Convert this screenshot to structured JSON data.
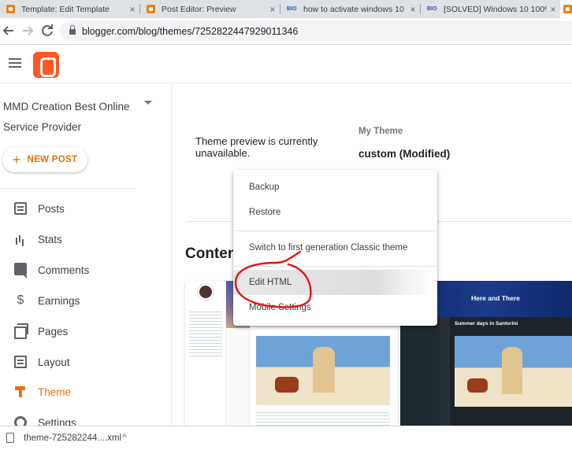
{
  "browser": {
    "tabs": [
      {
        "label": "Template: Edit Template",
        "favicon": "blogger-icon"
      },
      {
        "label": "Post Editor: Preview",
        "favicon": "blogger-icon"
      },
      {
        "label": "how to activate windows 10",
        "favicon": "microsoft-icon"
      },
      {
        "label": "[SOLVED] Windows 10 100%",
        "favicon": "microsoft-icon"
      }
    ],
    "close_glyph": "×",
    "ms_glyph": "BIO",
    "url": "blogger.com/blog/themes/7252822447929011346"
  },
  "sidebar": {
    "blog_name": "MMD Creation Best Online Service Provider",
    "new_post_label": "NEW POST",
    "new_post_glyph": "+",
    "items": [
      {
        "label": "Posts",
        "icon": "posts-icon",
        "active": false
      },
      {
        "label": "Stats",
        "icon": "stats-icon",
        "active": false
      },
      {
        "label": "Comments",
        "icon": "comments-icon",
        "active": false
      },
      {
        "label": "Earnings",
        "icon": "dollar-icon",
        "active": false
      },
      {
        "label": "Pages",
        "icon": "pages-icon",
        "active": false
      },
      {
        "label": "Layout",
        "icon": "layout-icon",
        "active": false
      },
      {
        "label": "Theme",
        "icon": "theme-icon",
        "active": true
      },
      {
        "label": "Settings",
        "icon": "gear-icon",
        "active": false
      }
    ],
    "earnings_glyph": "$"
  },
  "main": {
    "preview_message": "Theme preview is currently unavailable.",
    "my_theme_label": "My Theme",
    "theme_name": "custom (Modified)",
    "content_heading": "Contents",
    "thumb2_title": "Here and There",
    "thumb2_card_title": "Summer days in Santorini"
  },
  "menu": {
    "items": [
      {
        "label": "Backup"
      },
      {
        "label": "Restore"
      },
      {
        "label": "Switch to first generation Classic theme"
      },
      {
        "label": "Edit HTML",
        "hovered": true
      },
      {
        "label": "Mobile Settings"
      }
    ]
  },
  "download": {
    "filename": "theme-725282244....xml",
    "caret": "^"
  },
  "colors": {
    "accent": "#e8710a",
    "logo": "#ff5722",
    "annotation": "#e8140f"
  }
}
